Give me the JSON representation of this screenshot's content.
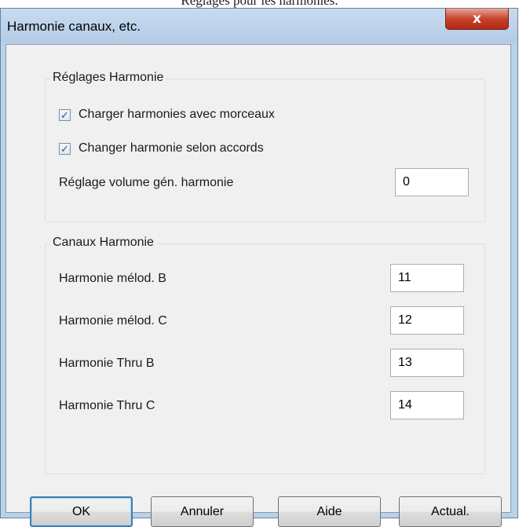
{
  "caption": "Réglages pour les harmonies.",
  "window": {
    "title": "Harmonie canaux, etc.",
    "close_glyph": "x"
  },
  "settings_group": {
    "label": "Réglages Harmonie",
    "load_with_songs": {
      "label": "Charger harmonies avec morceaux",
      "checked": true
    },
    "change_by_chords": {
      "label": "Changer harmonie selon accords",
      "checked": true
    },
    "volume": {
      "label": "Réglage volume gén. harmonie",
      "value": "0"
    }
  },
  "channels_group": {
    "label": "Canaux Harmonie",
    "rows": [
      {
        "label": "Harmonie mélod. B",
        "value": "11"
      },
      {
        "label": "Harmonie mélod. C",
        "value": "12"
      },
      {
        "label": "Harmonie Thru B",
        "value": "13"
      },
      {
        "label": "Harmonie Thru C",
        "value": "14"
      }
    ]
  },
  "buttons": {
    "ok": "OK",
    "cancel": "Annuler",
    "help": "Aide",
    "refresh": "Actual."
  },
  "check_glyph": "✓"
}
